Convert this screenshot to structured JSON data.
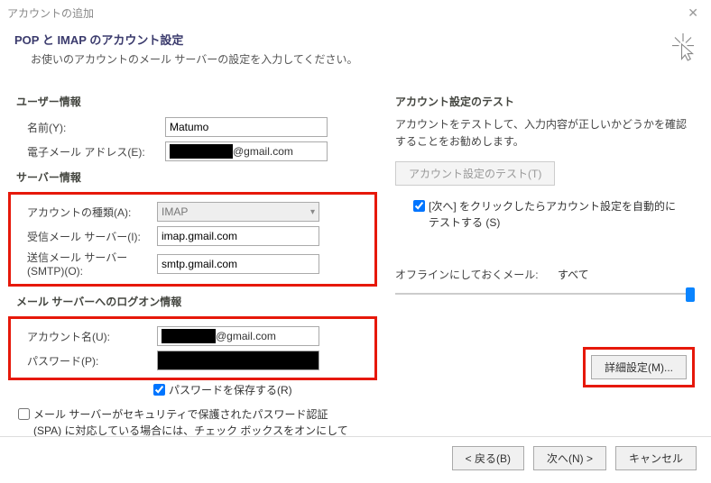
{
  "window": {
    "title": "アカウントの追加"
  },
  "header": {
    "title": "POP と IMAP のアカウント設定",
    "subtitle": "お使いのアカウントのメール サーバーの設定を入力してください。"
  },
  "left": {
    "user_section": "ユーザー情報",
    "name_label": "名前(Y):",
    "name_value": "Matumo",
    "email_label": "電子メール アドレス(E):",
    "email_suffix": "@gmail.com",
    "server_section": "サーバー情報",
    "account_type_label": "アカウントの種類(A):",
    "account_type_value": "IMAP",
    "incoming_label": "受信メール サーバー(I):",
    "incoming_value": "imap.gmail.com",
    "outgoing_label": "送信メール サーバー (SMTP)(O):",
    "outgoing_value": "smtp.gmail.com",
    "logon_section": "メール サーバーへのログオン情報",
    "account_name_label": "アカウント名(U):",
    "account_name_suffix": "@gmail.com",
    "password_label": "パスワード(P):",
    "save_password_label": "パスワードを保存する(R)",
    "spa_label": "メール サーバーがセキュリティで保護されたパスワード認証 (SPA) に対応している場合には、チェック ボックスをオンにしてください(Q)"
  },
  "right": {
    "test_section": "アカウント設定のテスト",
    "test_desc": "アカウントをテストして、入力内容が正しいかどうかを確認することをお勧めします。",
    "test_button": "アカウント設定のテスト(T)",
    "auto_test_label": "[次へ] をクリックしたらアカウント設定を自動的にテストする (S)",
    "offline_label": "オフラインにしておくメール:",
    "offline_value": "すべて",
    "details_button": "詳細設定(M)..."
  },
  "footer": {
    "back": "< 戻る(B)",
    "next": "次へ(N) >",
    "cancel": "キャンセル"
  }
}
